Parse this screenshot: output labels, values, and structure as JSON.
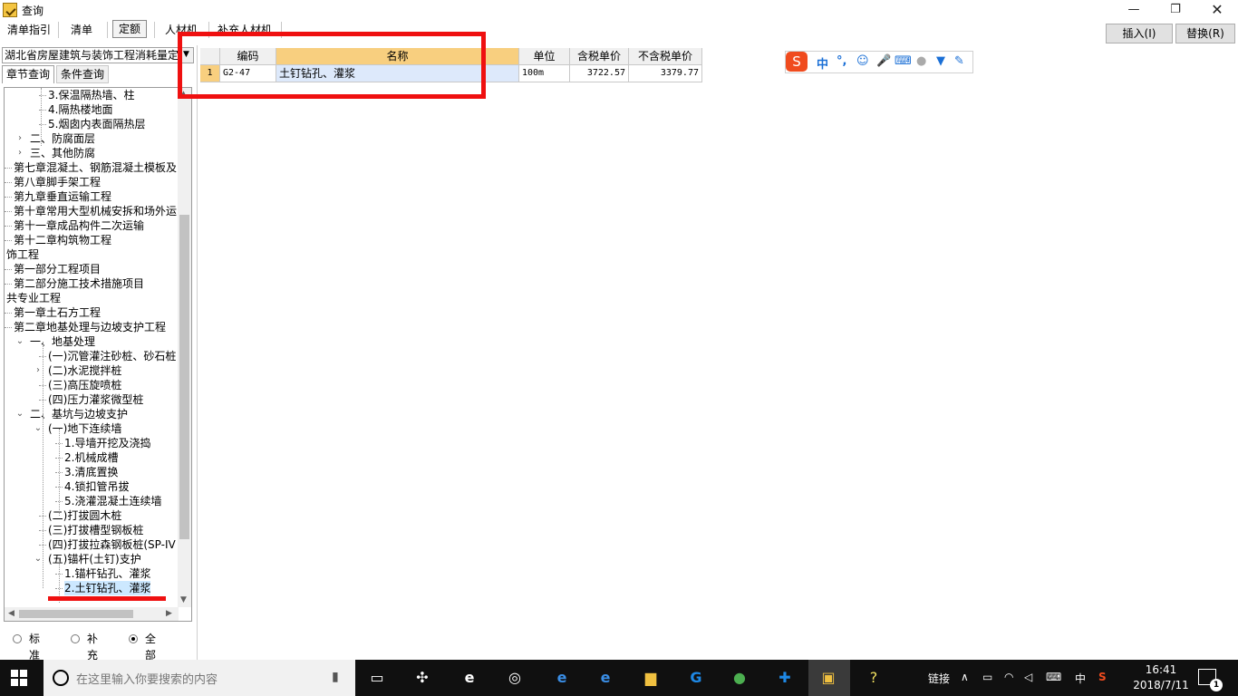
{
  "window": {
    "title": "查询",
    "minimize": "—",
    "maximize": "❐",
    "close": "✕"
  },
  "tabs": [
    {
      "label": "清单指引"
    },
    {
      "label": "清单"
    },
    {
      "label": "定额",
      "active": true
    },
    {
      "label": "人材机"
    },
    {
      "label": "补充人材机"
    }
  ],
  "toolbar": {
    "insert_label": "插入(I)",
    "replace_label": "替换(R)"
  },
  "left_panel": {
    "quota_library": "湖北省房屋建筑与装饰工程消耗量定额",
    "subtabs": [
      "章节查询",
      "条件查询"
    ],
    "tree": [
      "3.保温隔热墙、柱",
      "4.隔热楼地面",
      "5.烟囱内表面隔热层",
      "二、防腐面层",
      "三、其他防腐",
      "第七章混凝土、钢筋混凝土模板及",
      "第八章脚手架工程",
      "第九章垂直运输工程",
      "第十章常用大型机械安拆和场外运",
      "第十一章成品构件二次运输",
      "第十二章构筑物工程",
      "饰工程",
      "第一部分工程项目",
      "第二部分施工技术措施项目",
      "共专业工程",
      "第一章土石方工程",
      "第二章地基处理与边坡支护工程",
      "一、地基处理",
      "(一)沉管灌注砂桩、砂石桩",
      "(二)水泥搅拌桩",
      "(三)高压旋喷桩",
      "(四)压力灌浆微型桩",
      "二、基坑与边坡支护",
      "(一)地下连续墙",
      "1.导墙开挖及浇捣",
      "2.机械成槽",
      "3.清底置换",
      "4.锁扣管吊拔",
      "5.浇灌混凝土连续墙",
      "(二)打拔圆木桩",
      "(三)打拔槽型钢板桩",
      "(四)打拔拉森钢板桩(SP-IV",
      "(五)锚杆(土钉)支护",
      "1.锚杆钻孔、灌浆",
      "2.土钉钻孔、灌浆"
    ],
    "radios": [
      {
        "label": "标准",
        "checked": false
      },
      {
        "label": "补充",
        "checked": false
      },
      {
        "label": "全部",
        "checked": true
      }
    ]
  },
  "grid": {
    "headers": [
      "编码",
      "名称",
      "单位",
      "含税单价",
      "不含税单价"
    ],
    "rows": [
      {
        "no": "1",
        "code": "G2-47",
        "name": "土钉钻孔、灌浆",
        "unit": "100m",
        "price_tax": "3722.57",
        "price_notax": "3379.77"
      }
    ]
  },
  "ime": {
    "mode": "中",
    "punct": "°,"
  },
  "taskbar": {
    "search_placeholder": "在这里输入你要搜索的内容",
    "link_label": "链接",
    "ime_indicator": "中",
    "time": "16:41",
    "date": "2018/7/11",
    "notification_count": "1"
  },
  "colors": {
    "accent_header": "#f8cf7f",
    "selection": "#cce8ff",
    "annotation_red": "#ef1010"
  }
}
